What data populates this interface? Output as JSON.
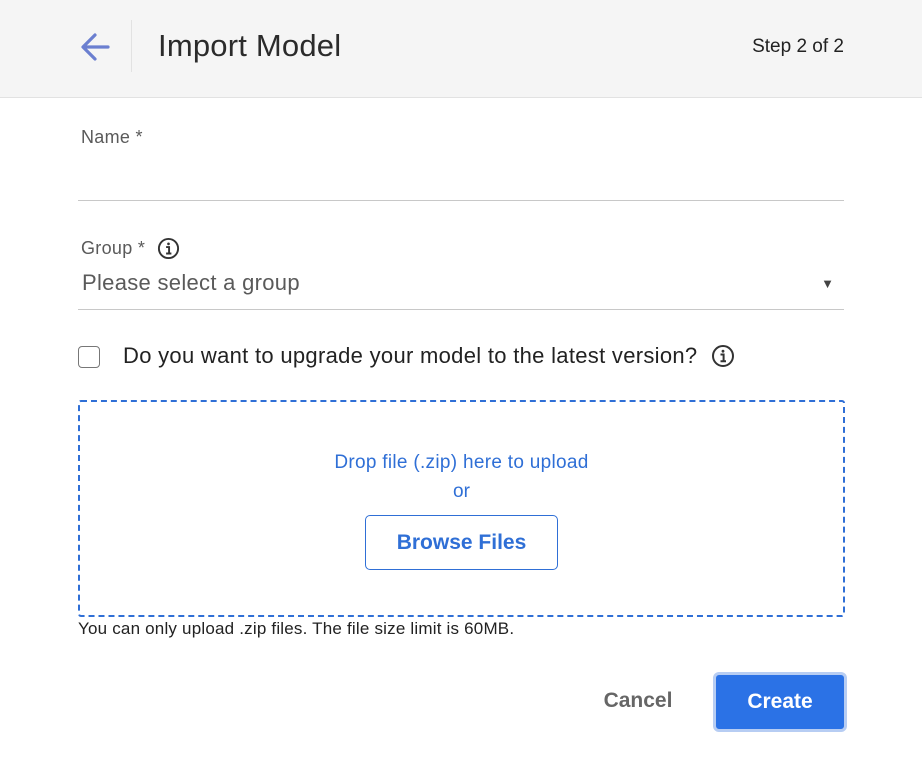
{
  "header": {
    "back_icon": "arrow-left-icon",
    "title": "Import Model",
    "step": "Step 2 of 2"
  },
  "form": {
    "name": {
      "label": "Name *",
      "value": ""
    },
    "group": {
      "label": "Group *",
      "info_icon": "info-circle-icon",
      "placeholder": "Please select a group",
      "caret_icon": "caret-down-icon"
    },
    "upgrade": {
      "label": "Do you want to upgrade your model to the latest version?",
      "checked": false,
      "info_icon": "info-circle-icon"
    }
  },
  "upload": {
    "drop_text": "Drop file (.zip) here to upload",
    "or_text": "or",
    "browse_label": "Browse Files",
    "hint": "You can only upload .zip files. The file size limit is 60MB."
  },
  "footer": {
    "cancel_label": "Cancel",
    "create_label": "Create"
  },
  "colors": {
    "accent": "#2f6fd6",
    "primary_button": "#2b72e6",
    "back_arrow": "#6b7fd0"
  }
}
